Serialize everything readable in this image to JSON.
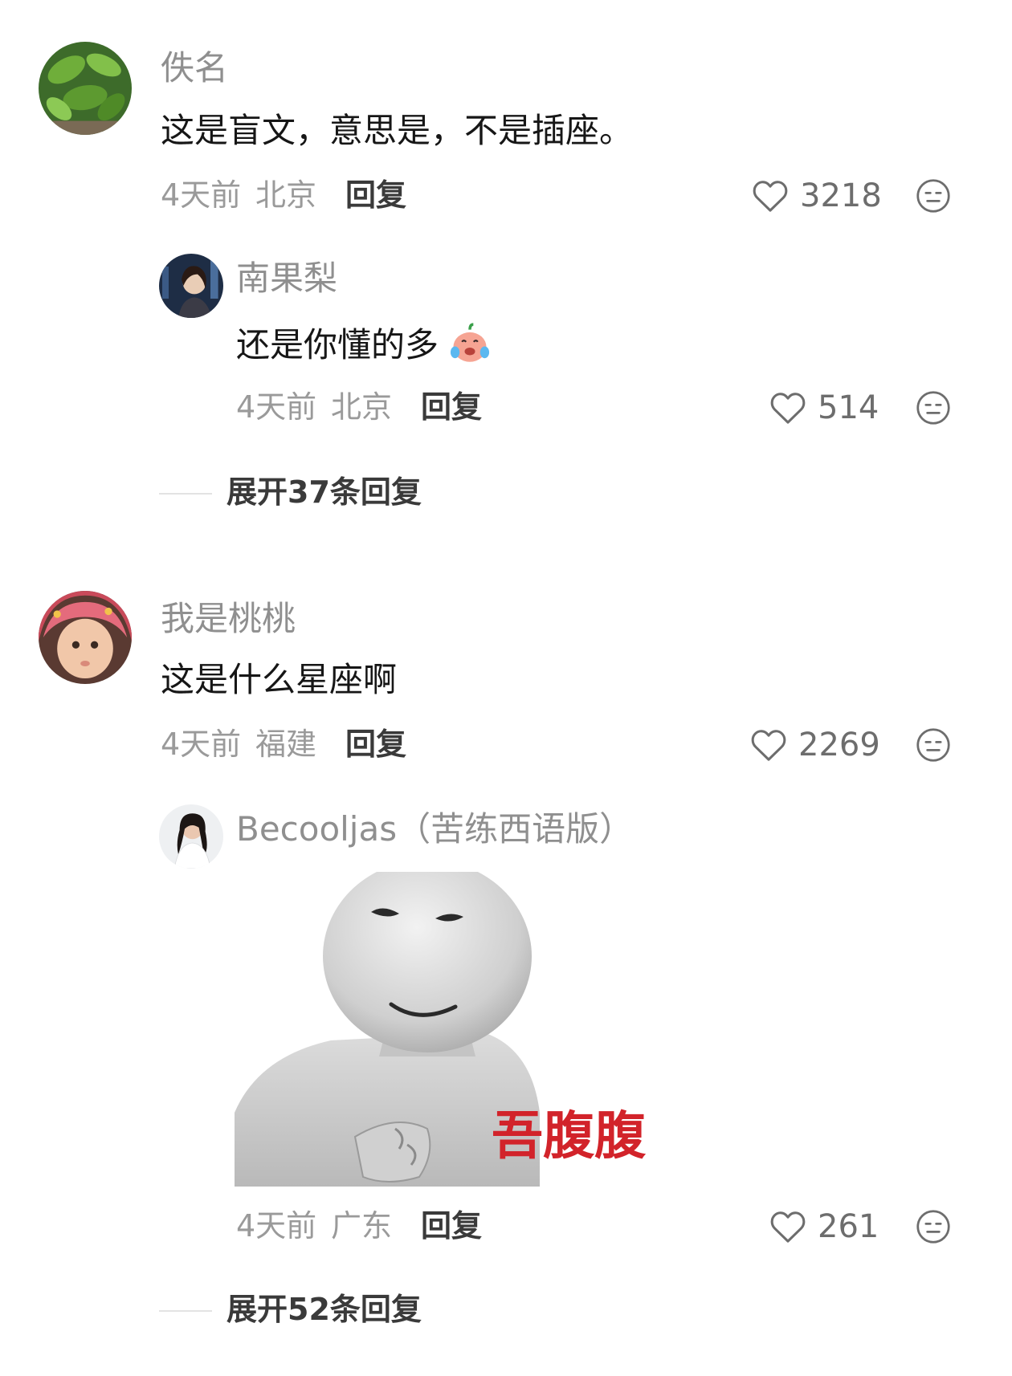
{
  "comments": [
    {
      "author": "佚名",
      "text": "这是盲文，意思是，不是插座。",
      "time": "4天前",
      "location": "北京",
      "reply_label": "回复",
      "likes": "3218",
      "avatar_icon": "plant-leaf-avatar",
      "replies": [
        {
          "author": "南果梨",
          "text": "还是你懂的多",
          "emoji_icon": "crying-laughing-emoji",
          "time": "4天前",
          "location": "北京",
          "reply_label": "回复",
          "likes": "514",
          "avatar_icon": "woman-city-night-avatar"
        }
      ],
      "expand_label": "展开37条回复"
    },
    {
      "author": "我是桃桃",
      "text": "这是什么星座啊",
      "time": "4天前",
      "location": "福建",
      "reply_label": "回复",
      "likes": "2269",
      "avatar_icon": "baby-headscarf-avatar",
      "replies": [
        {
          "author": "Becooljas（苦练西语版）",
          "sticker_caption": "吾腹腹",
          "time": "4天前",
          "location": "广东",
          "reply_label": "回复",
          "likes": "261",
          "avatar_icon": "woman-white-dress-avatar"
        }
      ],
      "expand_label": "展开52条回复"
    }
  ],
  "colors": {
    "background": "#ffffff",
    "author_name": "#8f8f8f",
    "comment_text": "#161616",
    "meta_text": "#9a9a9a",
    "sticker_caption": "#d2232a"
  }
}
